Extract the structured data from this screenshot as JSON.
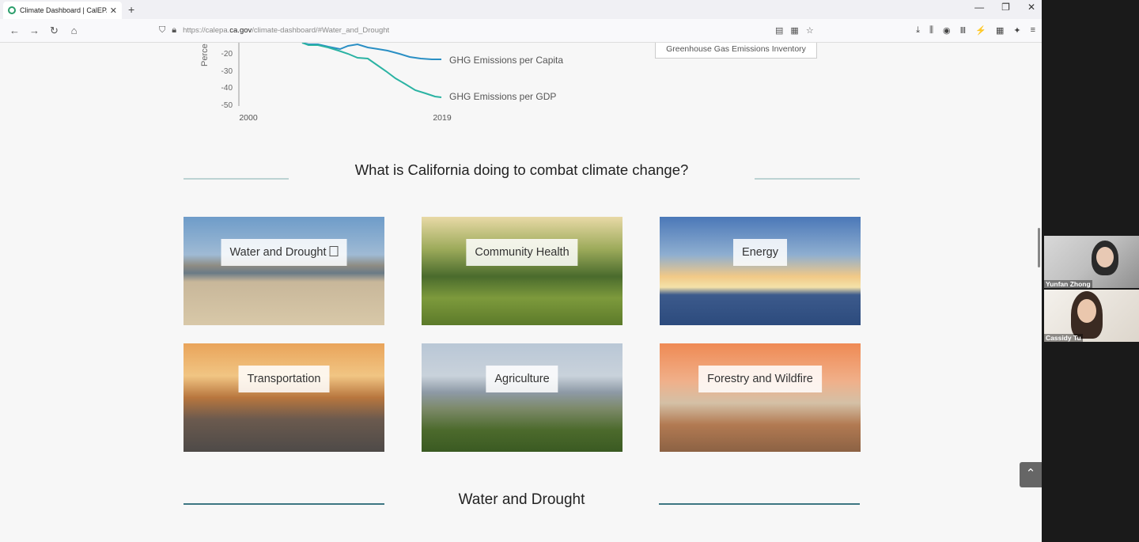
{
  "browser": {
    "tab_title": "Climate Dashboard | CalEPA",
    "url_prefix": "https://calepa.",
    "url_domain": "ca.gov",
    "url_path": "/climate-dashboard/#Water_and_Drought"
  },
  "chart_data": {
    "type": "line",
    "ylabel": "Perce",
    "y_ticks": [
      "-20",
      "-30",
      "-40",
      "-50"
    ],
    "x_ticks": [
      "2000",
      "2019"
    ],
    "series": [
      {
        "name": "GHG Emissions per Capita",
        "color": "#2a8fc4"
      },
      {
        "name": "GHG Emissions per GDP",
        "color": "#2bb3a3"
      }
    ]
  },
  "inventory_button": "Greenhouse Gas Emissions Inventory",
  "section_heading": "What is California doing to combat climate change?",
  "cards": [
    {
      "label": "Water and Drought"
    },
    {
      "label": "Community Health"
    },
    {
      "label": "Energy"
    },
    {
      "label": "Transportation"
    },
    {
      "label": "Agriculture"
    },
    {
      "label": "Forestry and Wildfire"
    }
  ],
  "water_heading": "Water and Drought",
  "participants": [
    {
      "name": "Yunfan Zhong"
    },
    {
      "name": "Cassidy Tu"
    }
  ]
}
